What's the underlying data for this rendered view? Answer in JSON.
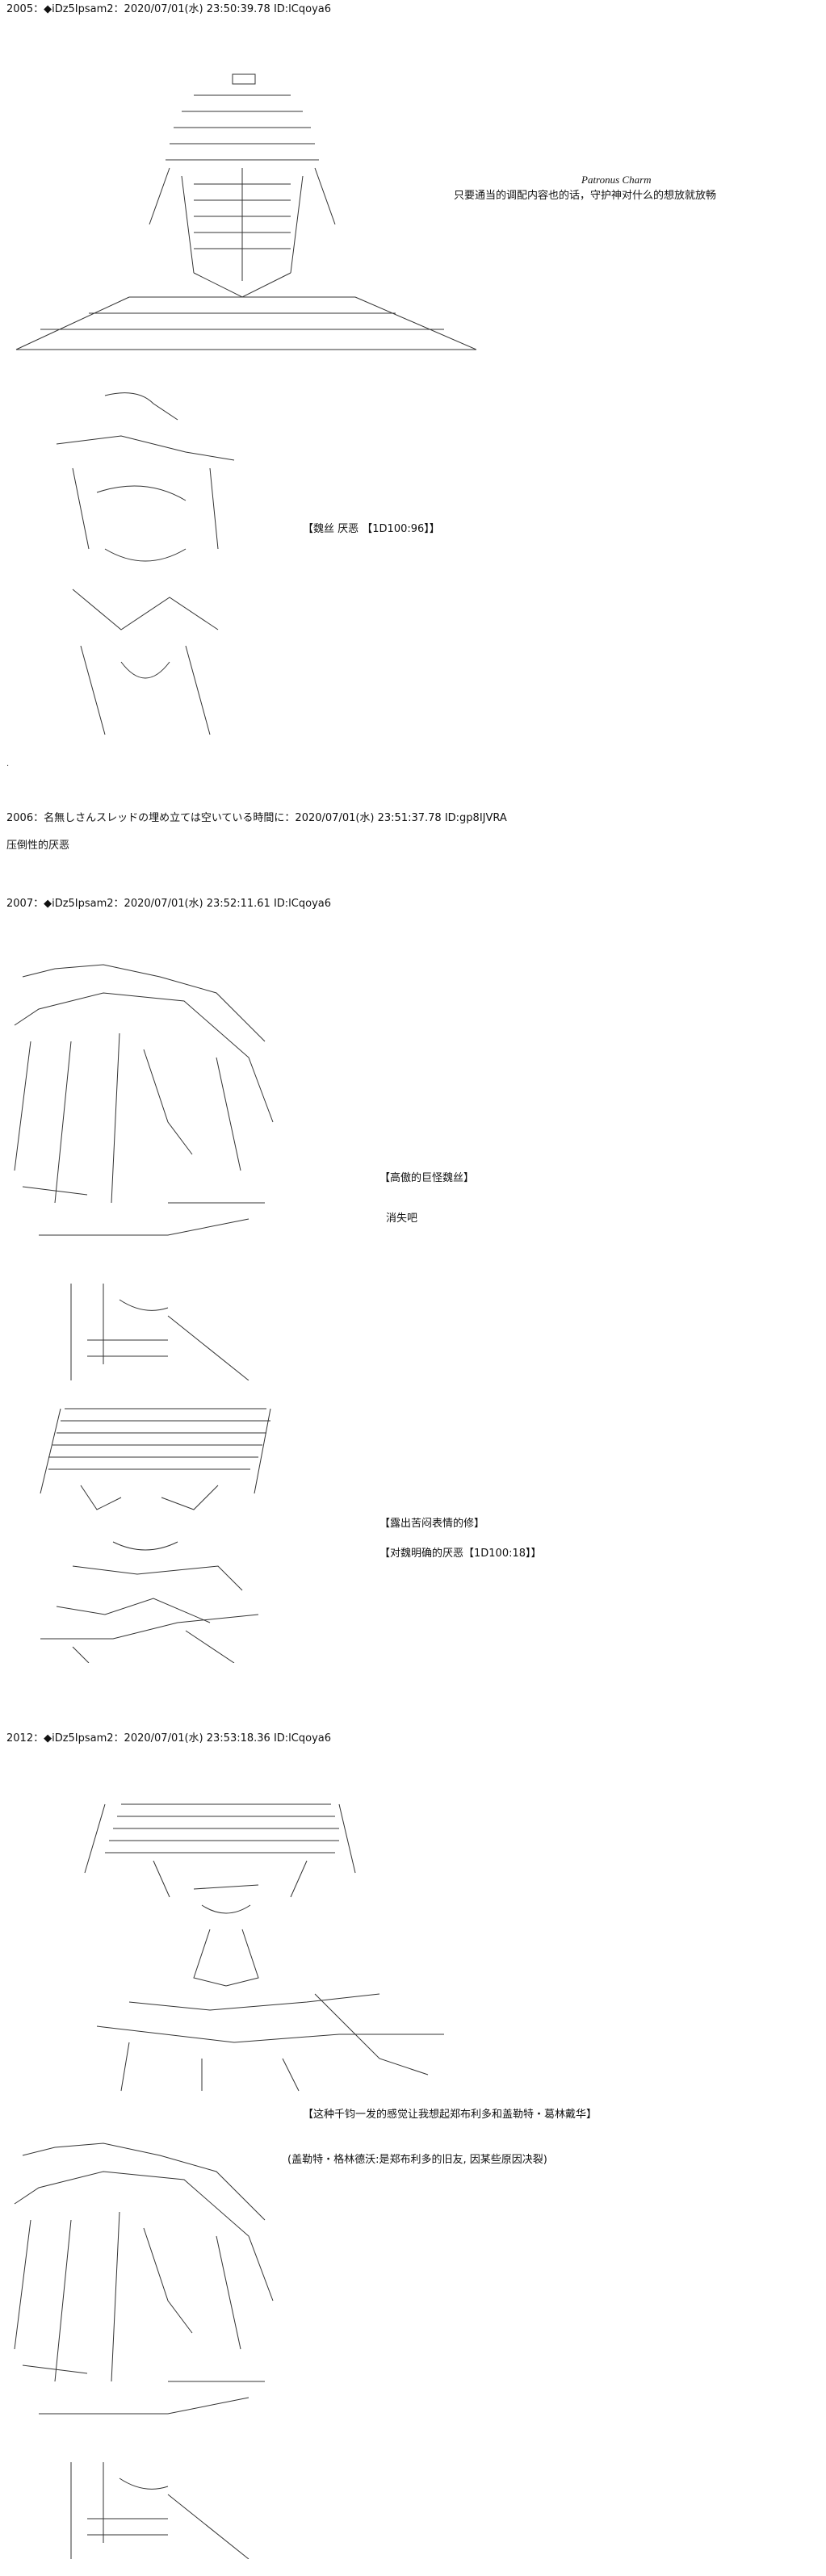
{
  "posts": [
    {
      "header": "2005：◆iDz5Ipsam2：2020/07/01(水) 23:50:39.78 ID:lCqoya6",
      "signature": "Patronus Charm",
      "text": "只要通当的调配内容也的话，守护神对什么的想放就放畅",
      "art_label": "robed figure ascii art"
    },
    {
      "art_label": "character with hand raised ascii art",
      "bracket_text": "【魏丝  厌恶  【1D100:96】】"
    },
    {
      "header": "2006：名無しさんスレッドの埋め立ては空いている時間に：2020/07/01(水) 23:51:37.78 ID:gp8IJVRA",
      "text": "压倒性的厌恶"
    },
    {
      "header": "2007：◆iDz5Ipsam2：2020/07/01(水) 23:52:11.61 ID:lCqoya6",
      "art_label": "hooded character ascii art",
      "lines": [
        "【高傲的巨怪魏丝】",
        "消失吧"
      ]
    },
    {
      "art_label": "character with striped hair ascii art",
      "lines": [
        "【露出苦闷表情的修】",
        "【对魏明确的厌恶【1D100:18】】"
      ]
    },
    {
      "header": "2012：◆iDz5Ipsam2：2020/07/01(水) 23:53:18.36 ID:lCqoya6",
      "art_label": "long haired character ascii art",
      "lines": [
        "【这种千钧一发的感觉让我想起郑布利多和盖勒特・葛林戴华】",
        "(盖勒特・格林德沃:是郑布利多的旧友, 因某些原因决裂)"
      ]
    },
    {
      "art_label": "hooded character ascii art repeat"
    }
  ],
  "trailing_dot": "."
}
